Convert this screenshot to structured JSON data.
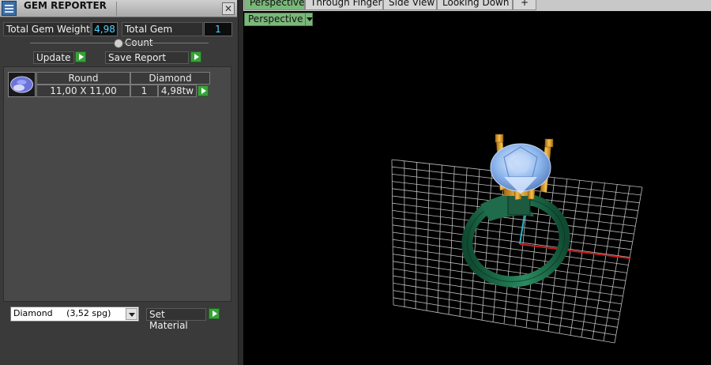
{
  "window": {
    "title": "GEM REPORTER",
    "close_glyph": "✕"
  },
  "stats": {
    "total_weight_label": "Total Gem Weight",
    "total_weight_value": "4,98",
    "total_count_label": "Total Gem Count",
    "total_count_value": "1"
  },
  "buttons": {
    "update": "Update",
    "save_report": "Save Report",
    "set_material": "Set Material"
  },
  "gem_table": {
    "headers": [
      "Round",
      "Diamond"
    ],
    "rows": [
      {
        "size": "11,00 X 11,00",
        "count": "1",
        "weight": "4,98tw"
      }
    ]
  },
  "material_select": {
    "value": "Diamond     (3,52 spg)"
  },
  "viewport": {
    "tabs": [
      {
        "label": "Perspective",
        "active": true
      },
      {
        "label": "Through Finger",
        "active": false
      },
      {
        "label": "Side View",
        "active": false
      },
      {
        "label": "Looking Down",
        "active": false
      }
    ],
    "add_tab_glyph": "+",
    "view_selector": "Perspective"
  },
  "colors": {
    "value_text": "#4fd3ff",
    "active_tab": "#7ab87a",
    "play_button": "#38a238",
    "ring_band": "#1f6b4b",
    "prongs": "#e0a32e",
    "gem": "#8ab4ec",
    "grid": "#bdbdbd",
    "axis_x": "#c81e1e",
    "axis_y": "#2fb6c8"
  },
  "icons": {
    "title": "gem-reporter-icon",
    "close": "close-icon",
    "play": "play-arrow-icon",
    "dropdown": "chevron-down-icon",
    "gem": "round-gem-icon"
  }
}
